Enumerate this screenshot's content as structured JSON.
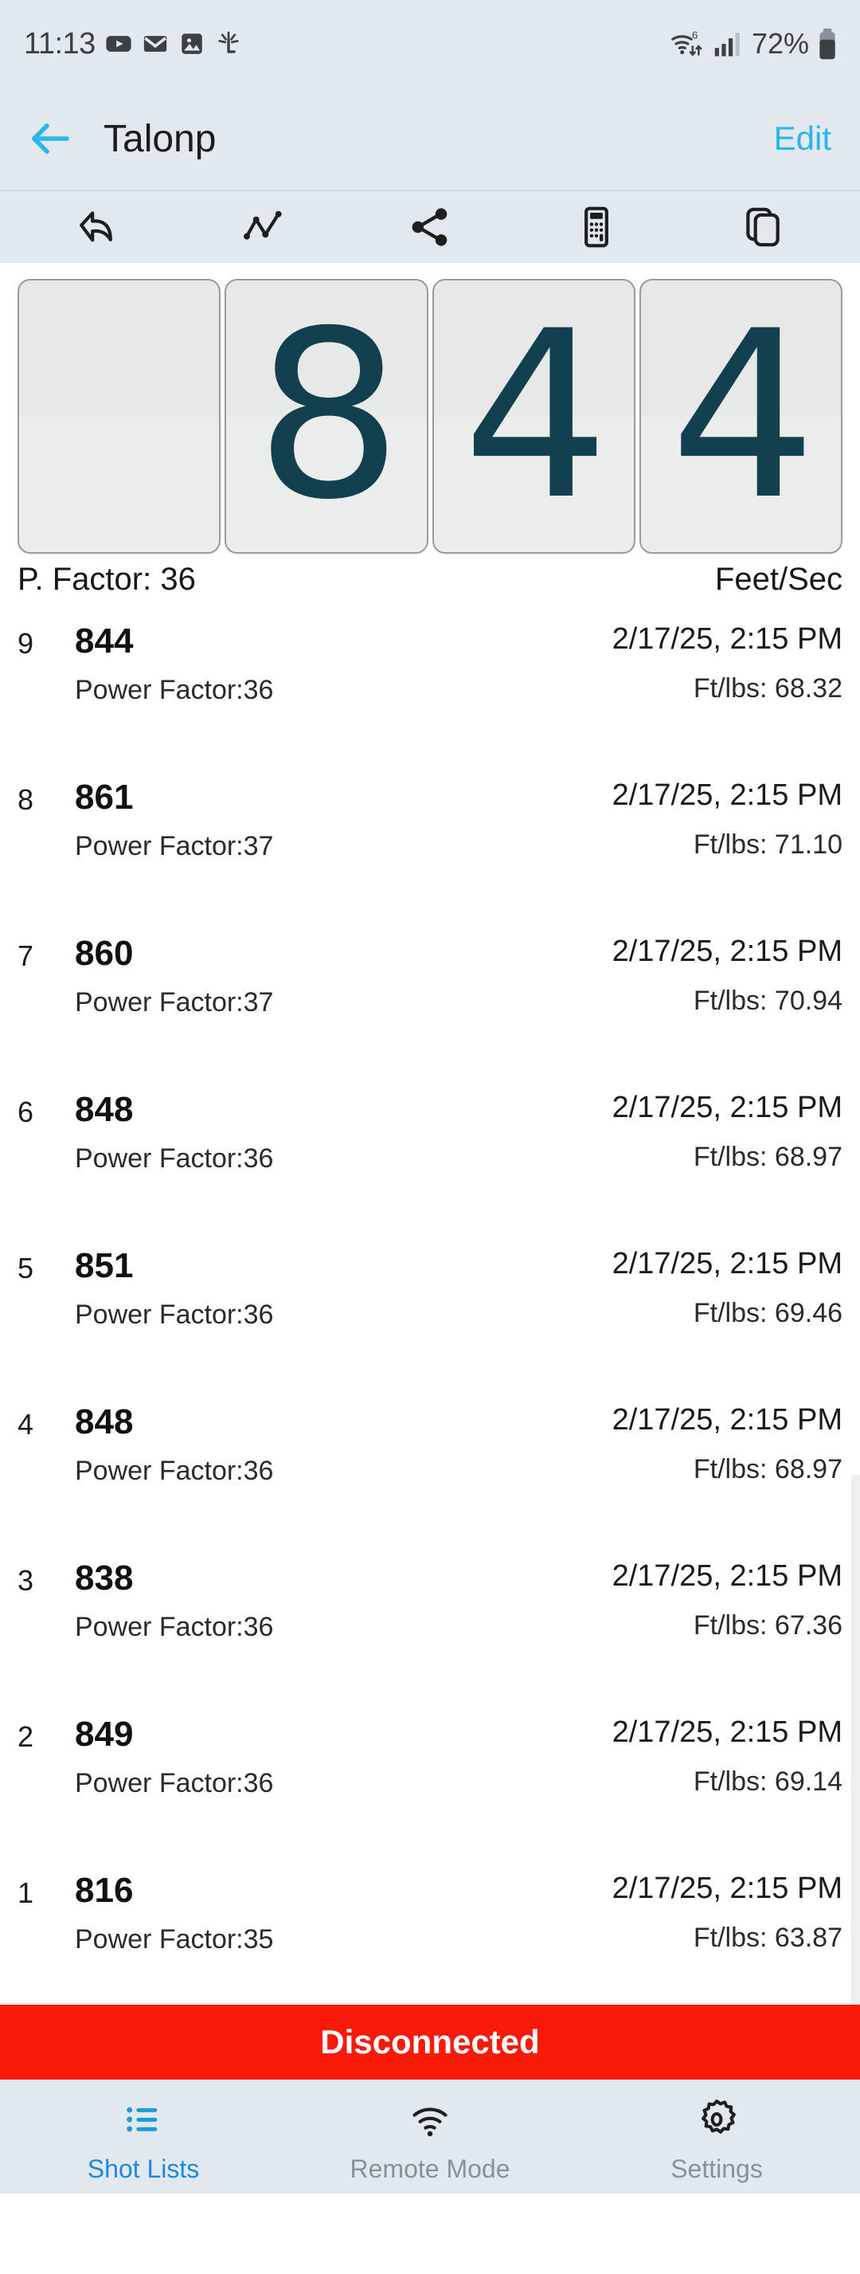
{
  "status_bar": {
    "time": "11:13",
    "left_icons": [
      "youtube-icon",
      "gmail-icon",
      "gallery-icon",
      "lg-health-icon"
    ],
    "wifi": "wifi-6-icon",
    "signal": "cell-signal-icon",
    "battery_percent": "72%",
    "battery_icon": "battery-icon"
  },
  "header": {
    "back_icon": "back-arrow-icon",
    "title": "Talonp",
    "edit_label": "Edit",
    "accent_color": "#29B6E8"
  },
  "toolbar": {
    "items": [
      {
        "name": "undo-icon"
      },
      {
        "name": "chart-line-icon"
      },
      {
        "name": "share-icon"
      },
      {
        "name": "calculator-icon"
      },
      {
        "name": "copy-icon"
      }
    ]
  },
  "readout": {
    "digits": [
      "",
      "8",
      "4",
      "4"
    ],
    "digit_color": "#12404F",
    "left_label": "P. Factor: 36",
    "right_label": "Feet/Sec"
  },
  "shot_list": {
    "columns": [
      "index",
      "velocity",
      "power_factor",
      "timestamp",
      "ft_lbs"
    ],
    "rows": [
      {
        "index": "9",
        "velocity": "844",
        "power_factor": "Power Factor:36",
        "timestamp": "2/17/25, 2:15 PM",
        "ft_lbs": "Ft/lbs: 68.32"
      },
      {
        "index": "8",
        "velocity": "861",
        "power_factor": "Power Factor:37",
        "timestamp": "2/17/25, 2:15 PM",
        "ft_lbs": "Ft/lbs: 71.10"
      },
      {
        "index": "7",
        "velocity": "860",
        "power_factor": "Power Factor:37",
        "timestamp": "2/17/25, 2:15 PM",
        "ft_lbs": "Ft/lbs: 70.94"
      },
      {
        "index": "6",
        "velocity": "848",
        "power_factor": "Power Factor:36",
        "timestamp": "2/17/25, 2:15 PM",
        "ft_lbs": "Ft/lbs: 68.97"
      },
      {
        "index": "5",
        "velocity": "851",
        "power_factor": "Power Factor:36",
        "timestamp": "2/17/25, 2:15 PM",
        "ft_lbs": "Ft/lbs: 69.46"
      },
      {
        "index": "4",
        "velocity": "848",
        "power_factor": "Power Factor:36",
        "timestamp": "2/17/25, 2:15 PM",
        "ft_lbs": "Ft/lbs: 68.97"
      },
      {
        "index": "3",
        "velocity": "838",
        "power_factor": "Power Factor:36",
        "timestamp": "2/17/25, 2:15 PM",
        "ft_lbs": "Ft/lbs: 67.36"
      },
      {
        "index": "2",
        "velocity": "849",
        "power_factor": "Power Factor:36",
        "timestamp": "2/17/25, 2:15 PM",
        "ft_lbs": "Ft/lbs: 69.14"
      },
      {
        "index": "1",
        "velocity": "816",
        "power_factor": "Power Factor:35",
        "timestamp": "2/17/25, 2:15 PM",
        "ft_lbs": "Ft/lbs: 63.87"
      }
    ]
  },
  "connection_banner": {
    "label": "Disconnected",
    "color": "#FA1A0A"
  },
  "bottom_nav": {
    "active_color": "#1E88E5",
    "inactive_color": "#8A9099",
    "items": [
      {
        "label": "Shot Lists",
        "icon": "list-icon",
        "active": true
      },
      {
        "label": "Remote Mode",
        "icon": "wifi-icon",
        "active": false
      },
      {
        "label": "Settings",
        "icon": "gear-icon",
        "active": false
      }
    ]
  }
}
